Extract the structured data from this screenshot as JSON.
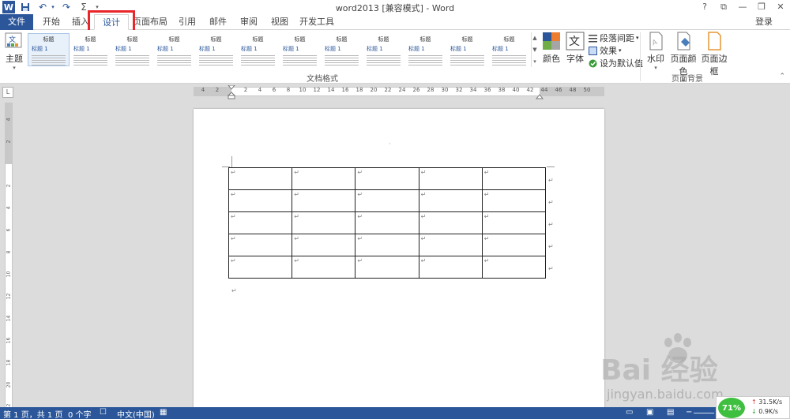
{
  "window": {
    "title": "word2013 [兼容模式] - Word",
    "login": "登录",
    "controls": [
      "?",
      "⧉",
      "—",
      "❐",
      "✕"
    ]
  },
  "quick_access": {
    "logo": "W",
    "icons": [
      "save-icon",
      "undo-icon",
      "redo-icon",
      "sum-icon",
      "customize-icon"
    ]
  },
  "tabs": [
    {
      "label": "文件"
    },
    {
      "label": "开始"
    },
    {
      "label": "插入"
    },
    {
      "label": "设计"
    },
    {
      "label": "页面布局"
    },
    {
      "label": "引用"
    },
    {
      "label": "邮件"
    },
    {
      "label": "审阅"
    },
    {
      "label": "视图"
    },
    {
      "label": "开发工具"
    }
  ],
  "ribbon": {
    "theme_label": "主题",
    "gallery_items": [
      {
        "title": "标题",
        "subtitle": "标题 1"
      },
      {
        "title": "标题",
        "subtitle": "标题 1"
      },
      {
        "title": "标题",
        "subtitle": "标题 1"
      },
      {
        "title": "标题",
        "subtitle": "标题 1"
      },
      {
        "title": "标题",
        "subtitle": "标题 1"
      },
      {
        "title": "标题",
        "subtitle": "标题 1"
      },
      {
        "title": "标题",
        "subtitle": "标题 1"
      },
      {
        "title": "标题",
        "subtitle": "标题 1"
      },
      {
        "title": "标题",
        "subtitle": "标题 1"
      },
      {
        "title": "标题",
        "subtitle": "标题 1"
      },
      {
        "title": "标题",
        "subtitle": "标题 1"
      },
      {
        "title": "标题",
        "subtitle": "标题 1"
      }
    ],
    "group_doc_format": "文档格式",
    "colors_label": "颜色",
    "fonts_label": "字体",
    "paragraph_spacing": "段落间距",
    "effects": "效果",
    "set_default": "设为默认值",
    "watermark_label": "水印",
    "page_color_label": "页面颜色",
    "page_border_label": "页面边框",
    "group_page_bg": "页面背景"
  },
  "ruler": {
    "corner": "L",
    "ticks": [
      "4",
      "2",
      "",
      "2",
      "4",
      "6",
      "8",
      "10",
      "12",
      "14",
      "16",
      "18",
      "20",
      "22",
      "24",
      "26",
      "28",
      "30",
      "32",
      "34",
      "36",
      "38",
      "40",
      "42",
      "44",
      "46",
      "48",
      "50"
    ],
    "vticks": [
      "4",
      "2",
      "",
      "2",
      "4",
      "6",
      "8",
      "10",
      "12",
      "14",
      "16",
      "18",
      "20",
      "22"
    ]
  },
  "document": {
    "rows": 5,
    "cols": 5,
    "cell_mark": "↵",
    "para_mark": "↵"
  },
  "statusbar": {
    "pages": "第 1 页，共 1 页",
    "words": "0 个字",
    "language": "中文(中国)"
  },
  "network": {
    "percent": "71%",
    "up": "31.5K/s",
    "down": "0.9K/s"
  },
  "watermark": {
    "logo": "Bai 经验",
    "url": "jingyan.baidu.com"
  }
}
